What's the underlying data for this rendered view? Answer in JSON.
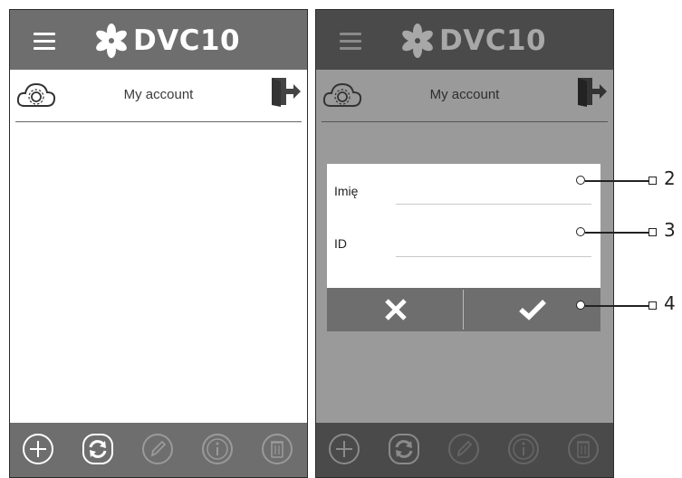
{
  "left_screen": {
    "app_title": "DVC10",
    "account_label": "My account"
  },
  "right_screen": {
    "app_title": "DVC10",
    "account_label": "My account",
    "dialog": {
      "name_label": "Imię",
      "id_label": "ID",
      "name_value": "",
      "id_value": ""
    }
  },
  "callouts": [
    "2",
    "3",
    "4"
  ],
  "icons": {
    "menu": "hamburger-icon",
    "logo": "fan-logo-icon",
    "settings": "cloud-gear-icon",
    "logout": "exit-door-icon",
    "add": "plus-circle-icon",
    "sync": "sync-icon",
    "edit": "pencil-icon",
    "info": "info-icon",
    "delete": "trash-icon",
    "cancel": "x-icon",
    "confirm": "check-icon"
  },
  "colors": {
    "bar": "#6e6e6e",
    "bar_dim": "#4a4a4a",
    "content_dim": "#9a9a9a",
    "white": "#ffffff"
  }
}
